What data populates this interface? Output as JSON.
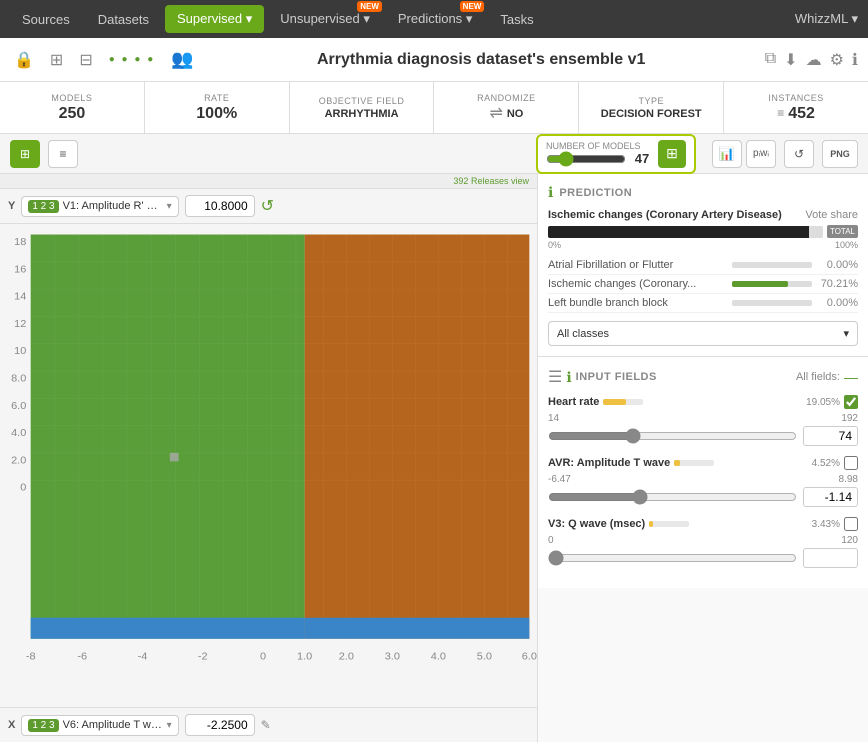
{
  "nav": {
    "sources": "Sources",
    "datasets": "Datasets",
    "supervised": "Supervised",
    "supervised_arrow": "▾",
    "unsupervised": "Unsupervised",
    "predictions": "Predictions",
    "predictions_arrow": "▾",
    "tasks": "Tasks",
    "whizzml": "WhizzML",
    "whizzml_arrow": "▾",
    "new_badge": "NEW"
  },
  "toolbar": {
    "lock_icon": "🔒",
    "tree_icon": "⊞",
    "blocks_icon": "⊟",
    "dots_icon": "● ● ● ●",
    "share_icon": "👥",
    "title": "Arrythmia diagnosis dataset's ensemble v1",
    "copy_icon": "⧉",
    "download_icon": "↓",
    "refresh_icon": "↺",
    "settings_icon": "⚙",
    "info_icon": "ℹ"
  },
  "stats": {
    "models_label": "MODELS",
    "models_value": "250",
    "rate_label": "RATE",
    "rate_value": "100%",
    "objective_label": "OBJECTIVE FIELD",
    "objective_value": "ARRHYTHMIA",
    "randomize_label": "RANDOMIZE",
    "randomize_icon": "⇌",
    "randomize_value": "NO",
    "type_label": "TYPE",
    "type_value": "DECISION FOREST",
    "instances_label": "INSTANCES",
    "instances_icon": "≡",
    "instances_value": "452"
  },
  "view_controls": {
    "grid_label": "⊞",
    "list_label": "≡",
    "num_models_label": "NUMBER OF MODELS",
    "num_models_value": "47",
    "num_models_min": 1,
    "num_models_max": 250,
    "chart_bar_icon": "📊",
    "chart_pw_icon": "pᵢwᵢ",
    "refresh_icon": "↺",
    "png_label": "PNG",
    "releases_text": "392 Releases view"
  },
  "y_axis": {
    "label": "Y",
    "field_badge": "1 2 3",
    "field_name": "V1: Amplitude R' w...",
    "field_arrow": "▾",
    "value": "10.8000",
    "refresh_icon": "↺"
  },
  "x_axis": {
    "label": "X",
    "field_badge": "1 2 3",
    "field_name": "V6: Amplitude T wa...",
    "field_arrow": "▾",
    "value": "-2.2500",
    "edit_icon": "✎"
  },
  "chart": {
    "y_ticks": [
      "18",
      "16",
      "14",
      "12",
      "10",
      "8.0",
      "6.0",
      "4.0",
      "2.0",
      "0"
    ],
    "x_ticks": [
      "-8",
      "-6",
      "-4",
      "-2",
      "0",
      "1.0",
      "2.0",
      "3.0",
      "4.0",
      "5.0",
      "6.0"
    ],
    "green_width_pct": 55,
    "brown_width_pct": 45,
    "blue_height_pct": 5,
    "marker_x_pct": 35,
    "marker_y_pct": 58
  },
  "prediction": {
    "section_icon": "ℹ",
    "section_title": "PREDICTION",
    "top_class": "Ischemic changes (Coronary Artery Disease)",
    "vote_share_label": "Vote share",
    "bar_start": "0%",
    "bar_end": "100%",
    "total_btn": "TOTAL",
    "classes": [
      {
        "name": "Atrial Fibrillation or Flutter",
        "pct": "0.00%",
        "fill_pct": 0
      },
      {
        "name": "Ischemic changes (Coronary...",
        "pct": "70.21%",
        "fill_pct": 70
      },
      {
        "name": "Left bundle branch block",
        "pct": "0.00%",
        "fill_pct": 0
      }
    ],
    "dropdown_value": "All classes",
    "dropdown_arrow": "▾"
  },
  "input_fields": {
    "section_icon": "ℹ",
    "section_title": "INPUT FIELDS",
    "all_fields_label": "All fields:",
    "collapse_icon": "—",
    "fields": [
      {
        "name": "Heart rate",
        "importance_pct": 19.05,
        "importance_label": "19.05%",
        "has_check": true,
        "min": 14,
        "max": 192,
        "value": "74",
        "slider_pct": 33
      },
      {
        "name": "AVR: Amplitude T wave",
        "importance_pct": 4.52,
        "importance_label": "4.52%",
        "has_check": false,
        "min": -6.47,
        "max": 8.98,
        "value": "-1.14",
        "slider_pct": 36
      },
      {
        "name": "V3: Q wave (msec)",
        "importance_pct": 3.43,
        "importance_label": "3.43%",
        "has_check": false,
        "min": 0,
        "max": 120,
        "value": "",
        "slider_pct": 0
      }
    ]
  }
}
